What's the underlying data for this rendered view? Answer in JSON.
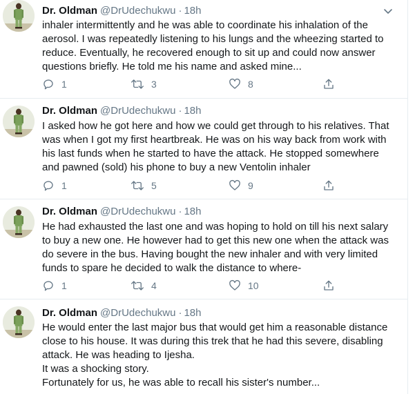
{
  "author": {
    "name": "Dr. Oldman",
    "handle": "@DrUdechukwu",
    "separator": "·"
  },
  "icons": {
    "reply": "reply-icon",
    "retweet": "retweet-icon",
    "like": "heart-icon",
    "share": "share-icon",
    "menu": "chevron-down-icon"
  },
  "colors": {
    "text": "#14171a",
    "secondary": "#657786",
    "divider": "#e6ecf0"
  },
  "tweets": [
    {
      "time": "18h",
      "lines": [
        "inhaler intermittently and he was able to coordinate his inhalation of the",
        "aerosol. I was repeatedly listening to his lungs and the wheezing started to",
        "reduce. Eventually, he recovered enough to sit up and could now answer",
        "questions briefly. He told me his name and asked mine..."
      ],
      "replies": "1",
      "retweets": "3",
      "likes": "8"
    },
    {
      "time": "18h",
      "lines": [
        "I asked how he got here and how we could get through to his relatives. That",
        "was when I got my first heartbreak. He was on his way back from work with",
        "his last funds when he started to have the attack. He stopped somewhere",
        "and pawned (sold) his phone to buy a new Ventolin inhaler"
      ],
      "replies": "1",
      "retweets": "5",
      "likes": "9"
    },
    {
      "time": "18h",
      "lines": [
        "He had exhausted the last one and was hoping to hold on till his next salary",
        "to buy a new one. He however had to get this new one when the attack was",
        "do severe in the bus. Having bought the new inhaler and with very limited",
        "funds to spare he decided to walk the distance to where-"
      ],
      "replies": "1",
      "retweets": "4",
      "likes": "10"
    },
    {
      "time": "18h",
      "lines": [
        "He would enter the last major bus that would get him a reasonable distance",
        "close to his house. It was during this trek that he had this severe, disabling",
        "attack. He was heading to Ijesha.",
        "It was a shocking story.",
        "Fortunately for us, he was able to recall his sister's number..."
      ]
    }
  ]
}
